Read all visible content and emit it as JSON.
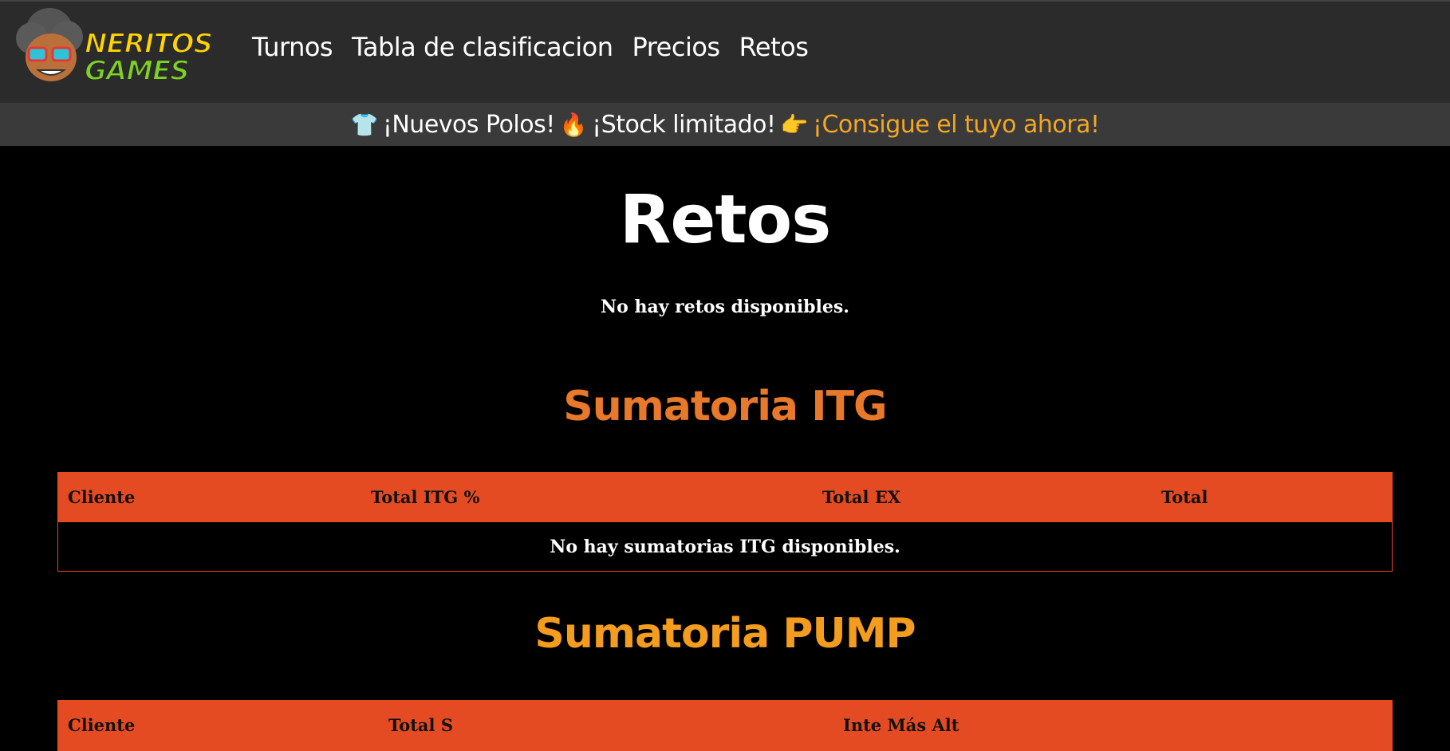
{
  "nav": {
    "logo_line1": "NERITOS",
    "logo_line2": "GAMES",
    "links": [
      "Turnos",
      "Tabla de clasificacion",
      "Precios",
      "Retos"
    ]
  },
  "promo": {
    "shirt_icon": "👕",
    "text1": "¡Nuevos Polos!",
    "fire_icon": "🔥",
    "text2": "¡Stock limitado!",
    "pointing_icon": "👉",
    "cta": "¡Consigue el tuyo ahora!"
  },
  "main": {
    "title": "Retos",
    "empty_message": "No hay retos disponibles."
  },
  "itg": {
    "title": "Sumatoria ITG",
    "headers": [
      "Cliente",
      "Total ITG %",
      "Total EX",
      "Total"
    ],
    "empty_message": "No hay sumatorias ITG disponibles."
  },
  "pump": {
    "title": "Sumatoria PUMP",
    "headers": [
      "Cliente",
      "Total S",
      "Inte Más Alt"
    ]
  },
  "colors": {
    "header_bg": "#2b2b2b",
    "promo_bg": "#3a3a3a",
    "accent": "#e44b22",
    "itg_title": "#e8782a",
    "pump_title": "#f39c1e",
    "cta": "#f5a623"
  }
}
